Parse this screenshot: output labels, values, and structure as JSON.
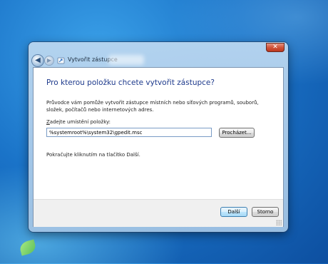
{
  "window": {
    "title": "Vytvořit zástupce",
    "close_symbol": "✕",
    "back_symbol": "◀",
    "forward_symbol": "▶"
  },
  "wizard": {
    "heading": "Pro kterou položku chcete vytvořit zástupce?",
    "description": "Průvodce vám pomůže vytvořit zástupce místních nebo síťových programů, souborů, složek, počítačů nebo internetových adres.",
    "field_label_accel": "Z",
    "field_label_rest": "adejte umístění položky:",
    "location_value": "%systemroot%\\system32\\gpedit.msc",
    "browse_label": "Procházet...",
    "continue_hint": "Pokračujte kliknutím na tlačítko Další."
  },
  "footer": {
    "next_label": "Další",
    "cancel_label": "Storno"
  },
  "icons": [
    "back-arrow-icon",
    "forward-arrow-icon",
    "shortcut-wizard-icon",
    "close-icon",
    "resize-grip-icon"
  ]
}
